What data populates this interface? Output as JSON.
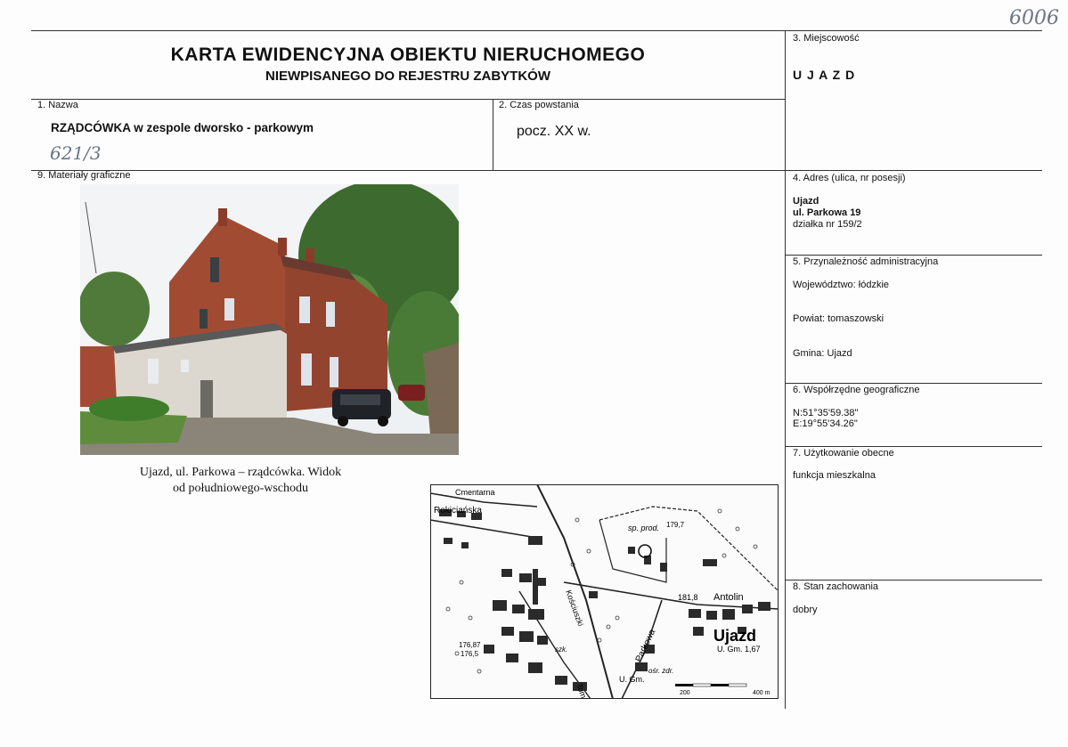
{
  "archive_number": "6006",
  "header": {
    "title": "KARTA EWIDENCYJNA OBIEKTU NIERUCHOMEGO",
    "subtitle": "NIEWPISANEGO DO REJESTRU ZABYTKÓW"
  },
  "fields": {
    "nazwa": {
      "label": "1. Nazwa",
      "value": "RZĄDCÓWKA w zespole dworsko - parkowym",
      "handwritten": "621/3"
    },
    "czas": {
      "label": "2. Czas powstania",
      "value": "pocz. XX w."
    },
    "miejscowosc": {
      "label": "3. Miejscowość",
      "value": "U J A Z D"
    },
    "adres": {
      "label": "4. Adres (ulica, nr posesji)",
      "line1": "Ujazd",
      "line2": "ul. Parkowa 19",
      "line3": "działka nr 159/2"
    },
    "przynaleznosc": {
      "label": "5. Przynależność administracyjna",
      "wojewodztwo": "Województwo: łódzkie",
      "powiat": "Powiat: tomaszowski",
      "gmina": "Gmina: Ujazd"
    },
    "wspolrzedne": {
      "label": "6. Współrzędne geograficzne",
      "n": "N:51°35'59.38\"",
      "e": "E:19°55'34.26\""
    },
    "uzytkowanie": {
      "label": "7. Użytkowanie obecne",
      "value": "funkcja mieszkalna"
    },
    "stan": {
      "label": "8. Stan zachowania",
      "value": "dobry"
    },
    "materialy": {
      "label": "9. Materiały graficzne"
    }
  },
  "photo": {
    "caption_line1": "Ujazd, ul. Parkowa – rządcówka. Widok",
    "caption_line2": "od południowego-wschodu"
  },
  "map": {
    "labels": {
      "cmentarna": "Cmentarna",
      "rokiciaska": "Rokiciańska",
      "sp_prod": "sp. prod.",
      "h1797": "179,7",
      "h1818": "181,8",
      "antolin": "Antolin",
      "ujazd": "Ujazd",
      "ugm": "U. Gm. 1,67",
      "h17687": "176,87",
      "h1765": "176,5",
      "szk": "szk.",
      "parkowa": "Parkowa",
      "osr_zdr": "ośr. zdr.",
      "ugm2": "U. Gm.",
      "tomaszowska": "Tomaszowska",
      "kosciuszki": "Kościuszki",
      "scale_200": "200",
      "scale_400": "400 m"
    }
  }
}
